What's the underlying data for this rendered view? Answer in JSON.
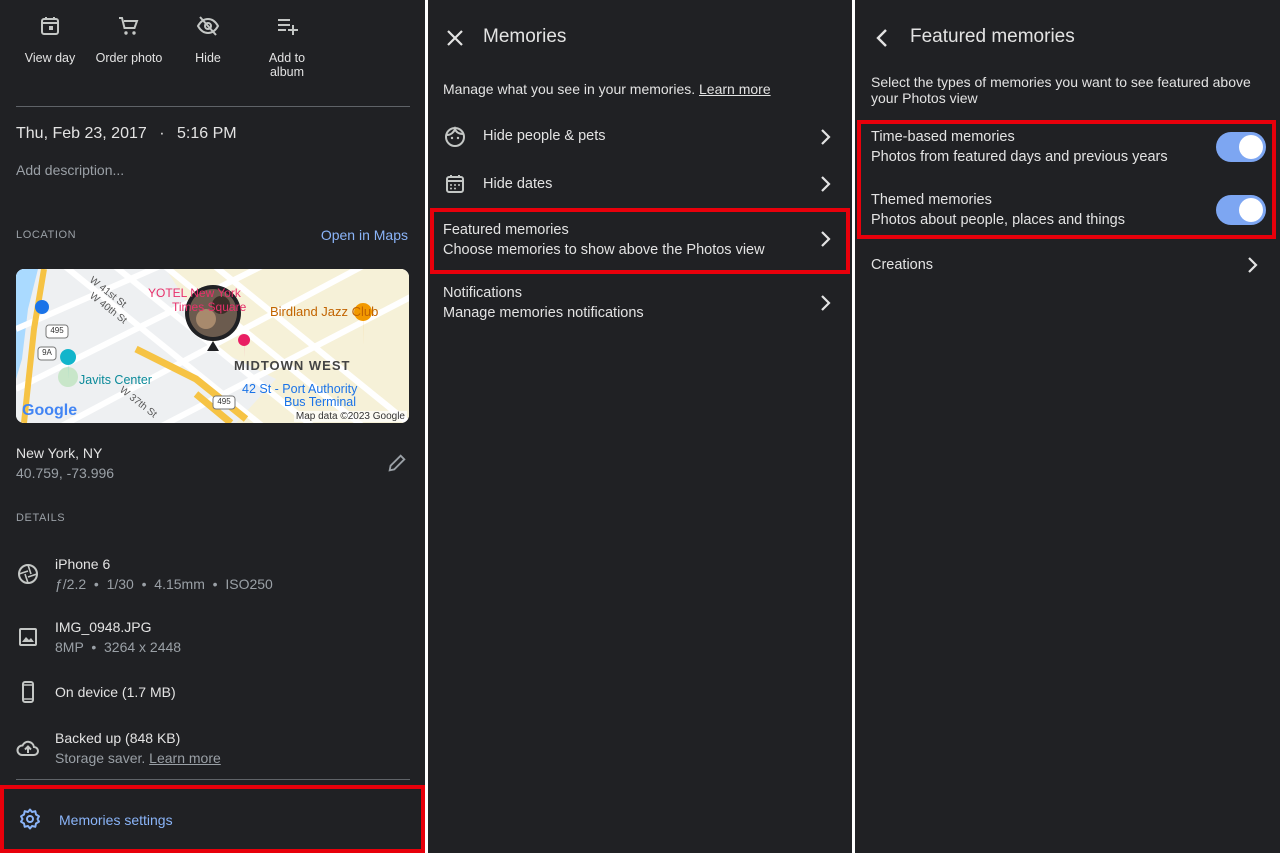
{
  "panel1": {
    "actions": [
      {
        "label": "View day"
      },
      {
        "label": "Order photo"
      },
      {
        "label": "Hide"
      },
      {
        "label": "Add to\nalbum"
      }
    ],
    "date": "Thu, Feb 23, 2017",
    "time": "5:16 PM",
    "date_sep": "·",
    "description_placeholder": "Add description...",
    "location_header": "LOCATION",
    "open_maps": "Open in Maps",
    "map": {
      "labels": {
        "w41": "W 41st St",
        "w40": "W 40th St",
        "w37": "W 37th St",
        "yotel": "YOTEL New York",
        "yotel2": "Times Square",
        "birdland": "Birdland Jazz Club",
        "midtown": "MIDTOWN WEST",
        "javits": "Javits Center",
        "port1": "42 St - Port Authority",
        "port2": "Bus Terminal",
        "rt495a": "495",
        "rt495b": "495",
        "rt9a": "9A",
        "google": "Google",
        "mapdata": "Map data ©2023 Google"
      }
    },
    "place_name": "New York, NY",
    "coords": "40.759, -73.996",
    "details_header": "DETAILS",
    "camera": {
      "title": "iPhone 6",
      "sub": "ƒ/2.2  •  1/30  •  4.15mm  •  ISO250"
    },
    "file": {
      "title": "IMG_0948.JPG",
      "sub": "8MP  •  3264 x 2448"
    },
    "device": {
      "title": "On device (1.7 MB)"
    },
    "backup": {
      "title": "Backed up (848 KB)",
      "sub_prefix": "Storage saver. ",
      "sub_link": "Learn more"
    },
    "memories_settings": "Memories settings"
  },
  "panel2": {
    "title": "Memories",
    "intro_prefix": "Manage what you see in your memories. ",
    "intro_link": "Learn more",
    "items": [
      {
        "title": "Hide people & pets"
      },
      {
        "title": "Hide dates"
      },
      {
        "title": "Featured memories",
        "sub": "Choose memories to show above the Photos view"
      },
      {
        "title": "Notifications",
        "sub": "Manage memories notifications"
      }
    ]
  },
  "panel3": {
    "title": "Featured memories",
    "intro": "Select the types of memories you want to see featured above your Photos view",
    "toggles": [
      {
        "title": "Time-based memories",
        "sub": "Photos from featured days and previous years",
        "on": true
      },
      {
        "title": "Themed memories",
        "sub": "Photos about people, places and things",
        "on": true
      }
    ],
    "creations": "Creations"
  },
  "colors": {
    "background": "#202124",
    "accent": "#8ab4f8",
    "toggle_on": "#7da6f2",
    "highlight": "#e8000b"
  }
}
